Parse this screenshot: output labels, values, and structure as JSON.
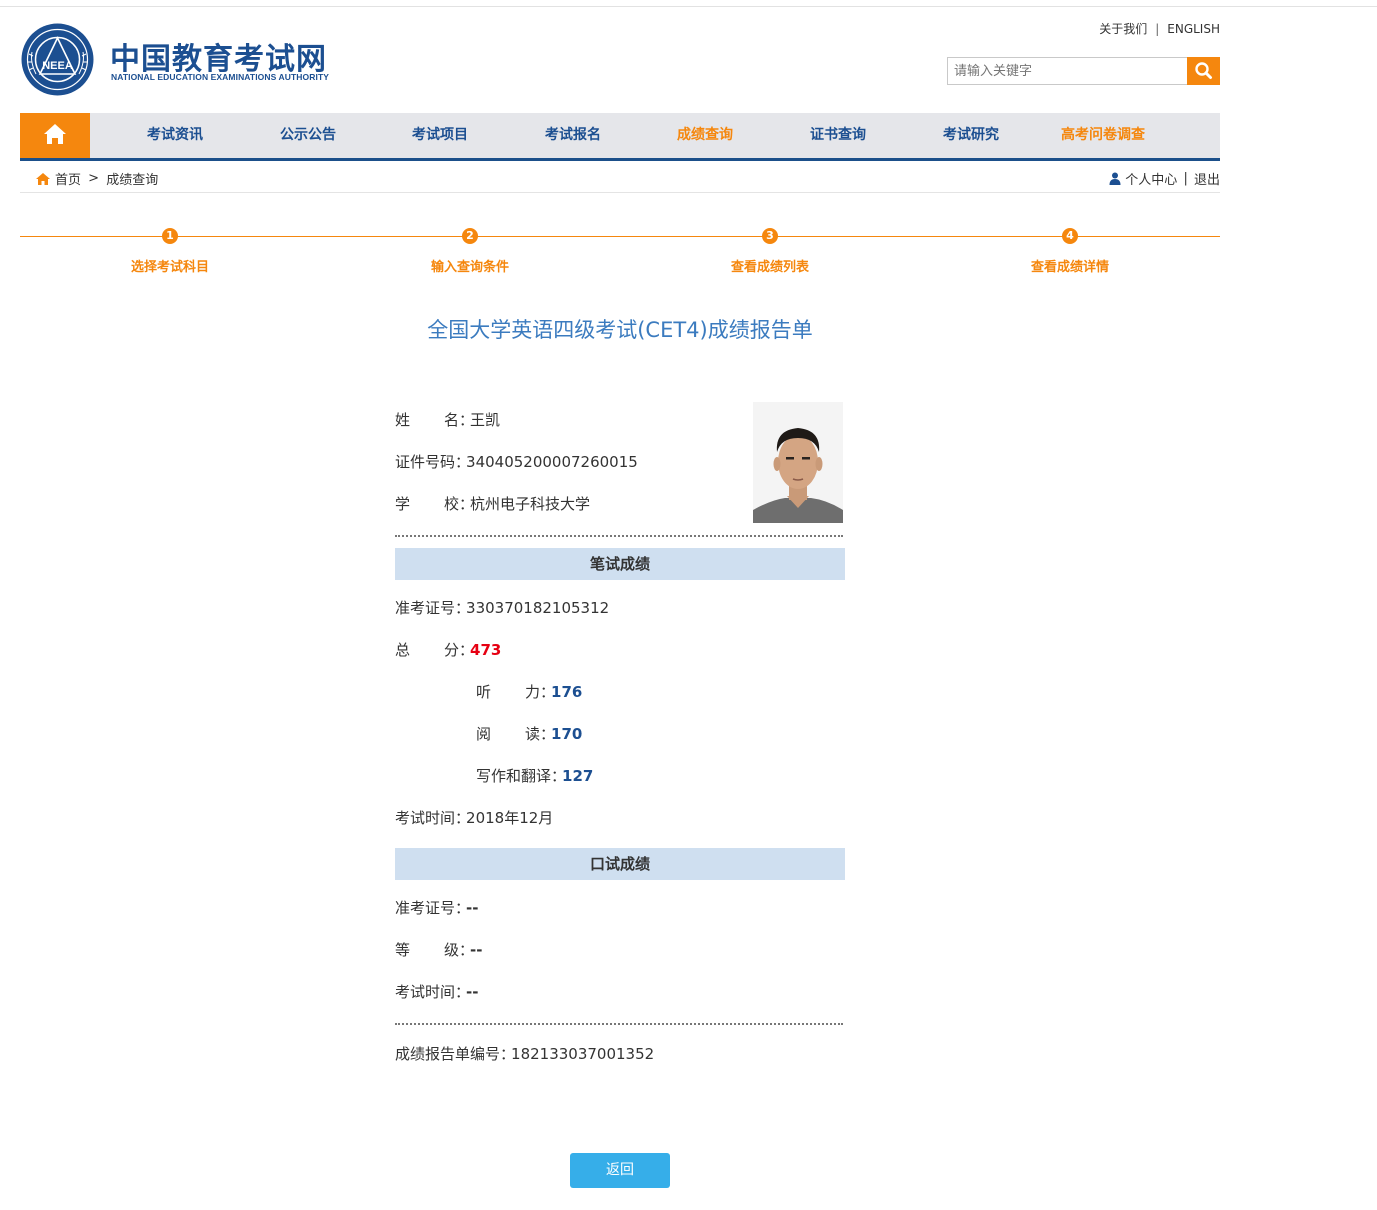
{
  "header": {
    "logo_cn": "中国教育考试网",
    "logo_en": "NATIONAL EDUCATION EXAMINATIONS AUTHORITY",
    "logo_emblem_text": "NEEA",
    "about_label": "关于我们",
    "separator": "|",
    "english_label": "ENGLISH",
    "search_placeholder": "请输入关键字"
  },
  "nav": {
    "items": [
      {
        "label": "考试资讯"
      },
      {
        "label": "公示公告"
      },
      {
        "label": "考试项目"
      },
      {
        "label": "考试报名"
      },
      {
        "label": "成绩查询"
      },
      {
        "label": "证书查询"
      },
      {
        "label": "考试研究"
      },
      {
        "label": "高考问卷调查"
      }
    ],
    "accent_color": "#f5870e",
    "primary_color": "#1c4f91"
  },
  "breadcrumb": {
    "home": "首页",
    "sep": ">",
    "current": "成绩查询",
    "user_center": "个人中心",
    "divider": "|",
    "logout": "退出"
  },
  "steps": [
    {
      "num": "1",
      "label": "选择考试科目"
    },
    {
      "num": "2",
      "label": "输入查询条件"
    },
    {
      "num": "3",
      "label": "查看成绩列表"
    },
    {
      "num": "4",
      "label": "查看成绩详情"
    }
  ],
  "report": {
    "title": "全国大学英语四级考试(CET4)成绩报告单",
    "name_label": "姓名",
    "name": "王凯",
    "id_label": "证件号码",
    "id": "340405200007260015",
    "school_label": "学校",
    "school": "杭州电子科技大学",
    "colon": "：",
    "written": {
      "section": "笔试成绩",
      "ticket_label": "准考证号",
      "ticket": "330370182105312",
      "total_label": "总分",
      "total": "473",
      "listening_label": "听力",
      "listening": "176",
      "reading_label": "阅读",
      "reading": "170",
      "writing_label": "写作和翻译",
      "writing": "127",
      "time_label": "考试时间",
      "time": "2018年12月"
    },
    "oral": {
      "section": "口试成绩",
      "ticket_label": "准考证号",
      "ticket": "--",
      "grade_label": "等级",
      "grade": "--",
      "time_label": "考试时间",
      "time": "--"
    },
    "report_no_label": "成绩报告单编号",
    "report_no": "182133037001352"
  },
  "back_label": "返回"
}
